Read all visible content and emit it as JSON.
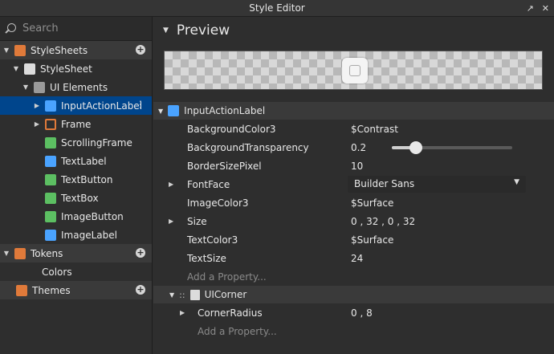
{
  "window": {
    "title": "Style Editor",
    "btn_popout": "↗",
    "btn_close": "✕"
  },
  "search": {
    "placeholder": "Search"
  },
  "tree": {
    "stylesheets": "StyleSheets",
    "stylesheet": "StyleSheet",
    "ui_elements": "UI Elements",
    "items": [
      {
        "label": "InputActionLabel",
        "icon": "input-action-icon"
      },
      {
        "label": "Frame",
        "icon": "frame-icon"
      },
      {
        "label": "ScrollingFrame",
        "icon": "scrolling-frame-icon"
      },
      {
        "label": "TextLabel",
        "icon": "text-label-icon"
      },
      {
        "label": "TextButton",
        "icon": "text-button-icon"
      },
      {
        "label": "TextBox",
        "icon": "text-box-icon"
      },
      {
        "label": "ImageButton",
        "icon": "image-button-icon"
      },
      {
        "label": "ImageLabel",
        "icon": "image-label-icon"
      }
    ],
    "tokens": "Tokens",
    "colors": "Colors",
    "themes": "Themes"
  },
  "preview": {
    "label": "Preview"
  },
  "properties": {
    "header": "InputActionLabel",
    "rows": [
      {
        "name": "BackgroundColor3",
        "value": "$Contrast"
      },
      {
        "name": "BackgroundTransparency",
        "value": "0.2",
        "slider": 0.2
      },
      {
        "name": "BorderSizePixel",
        "value": "10"
      },
      {
        "name": "FontFace",
        "value": "Builder Sans"
      },
      {
        "name": "ImageColor3",
        "value": "$Surface"
      },
      {
        "name": "Size",
        "value": "0 , 32 , 0 , 32"
      },
      {
        "name": "TextColor3",
        "value": "$Surface"
      },
      {
        "name": "TextSize",
        "value": "24"
      }
    ],
    "add_property": "Add a Property...",
    "sub_header": "UICorner",
    "sub_rows": [
      {
        "name": "CornerRadius",
        "value": "0 , 8"
      }
    ],
    "sub_add_property": "Add a Property..."
  }
}
